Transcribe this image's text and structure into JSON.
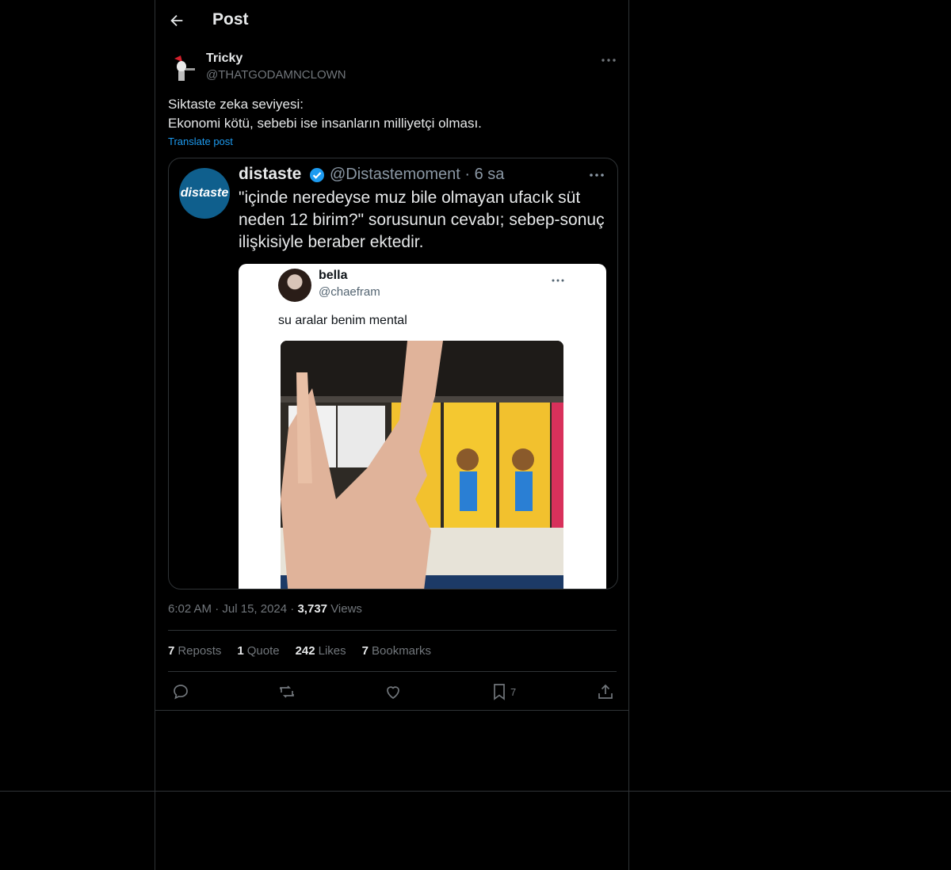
{
  "header": {
    "title": "Post"
  },
  "post": {
    "author_name": "Tricky",
    "author_handle": "@THATGODAMNCLOWN",
    "text_line1": "Siktaste zeka seviyesi:",
    "text_line2": "Ekonomi kötü, sebebi ise insanların milliyetçi olması.",
    "translate_label": "Translate post"
  },
  "quoted_image": {
    "avatar_text": "distaste",
    "name": "distaste",
    "handle_time": "@Distastemoment · 6 sa",
    "text": "\"içinde neredeyse muz bile olmayan ufacık süt neden 12 birim?\" sorusunun cevabı; sebep-sonuç ilişkisiyle beraber ektedir.",
    "inner": {
      "name": "bella",
      "handle": "@chaefram",
      "text": "su aralar benim mental"
    }
  },
  "meta": {
    "time": "6:02 AM",
    "sep1": " · ",
    "date": "Jul 15, 2024",
    "sep2": " · ",
    "views_count": "3,737",
    "views_label": "Views"
  },
  "stats": {
    "reposts_count": "7",
    "reposts_label": "Reposts",
    "quotes_count": "1",
    "quotes_label": "Quote",
    "likes_count": "242",
    "likes_label": "Likes",
    "bookmarks_count": "7",
    "bookmarks_label": "Bookmarks"
  },
  "actions": {
    "bookmark_count": "7"
  },
  "colors": {
    "accent": "#1d9bf0",
    "border": "#2f3336",
    "muted": "#71767b"
  }
}
